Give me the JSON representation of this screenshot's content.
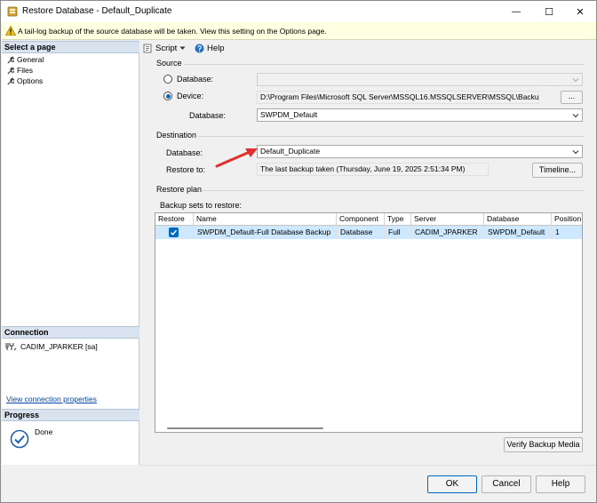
{
  "window": {
    "title": "Restore Database - Default_Duplicate",
    "minimize_glyph": "—",
    "maximize_glyph": "☐",
    "close_glyph": "✕"
  },
  "warning": {
    "text": "A tail-log backup of the source database will be taken. View this setting on the Options page.",
    "icon": "warning-icon"
  },
  "left_pane": {
    "select_page_header": "Select a page",
    "pages": [
      {
        "label": "General",
        "icon": "wrench-icon"
      },
      {
        "label": "Files",
        "icon": "wrench-icon"
      },
      {
        "label": "Options",
        "icon": "wrench-icon"
      }
    ],
    "connection_header": "Connection",
    "connection_server": "CADIM_JPARKER [sa]",
    "view_connection_link": "View connection properties",
    "progress_header": "Progress",
    "progress_status": "Done"
  },
  "toolbar": {
    "script_label": "Script",
    "help_label": "Help"
  },
  "source": {
    "group_label": "Source",
    "database_radio_label": "Database:",
    "device_radio_label": "Device:",
    "device_path": "D:\\Program Files\\Microsoft SQL Server\\MSSQL16.MSSQLSERVER\\MSSQL\\Backup",
    "browse_label": "...",
    "database_label": "Database:",
    "database_value": "SWPDM_Default"
  },
  "destination": {
    "group_label": "Destination",
    "database_label": "Database:",
    "database_value": "Default_Duplicate",
    "restore_to_label": "Restore to:",
    "restore_to_value": "The last backup taken (Thursday, June 19, 2025 2:51:34 PM)",
    "timeline_label": "Timeline..."
  },
  "restore_plan": {
    "group_label": "Restore plan",
    "backup_sets_label": "Backup sets to restore:",
    "columns": [
      "Restore",
      "Name",
      "Component",
      "Type",
      "Server",
      "Database",
      "Position"
    ],
    "rows": [
      {
        "restore": true,
        "name": "SWPDM_Default-Full Database Backup",
        "component": "Database",
        "type": "Full",
        "server": "CADIM_JPARKER",
        "database": "SWPDM_Default",
        "position": "1"
      }
    ],
    "verify_label": "Verify Backup Media"
  },
  "footer": {
    "ok_label": "OK",
    "cancel_label": "Cancel",
    "help_label": "Help"
  },
  "colors": {
    "accent": "#0067c0",
    "selection": "#cde8ff",
    "arrow": "#e03030"
  }
}
